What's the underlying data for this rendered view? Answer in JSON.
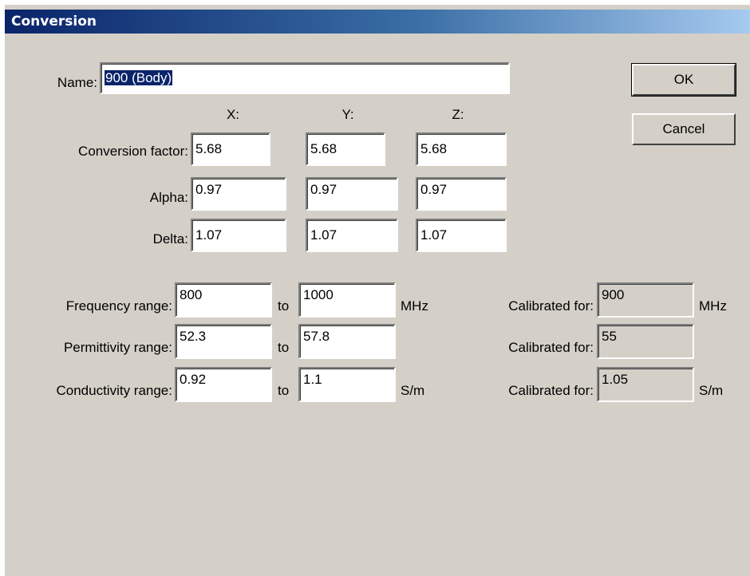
{
  "window": {
    "title": "Conversion"
  },
  "name": {
    "label": "Name:",
    "value": "900 (Body)"
  },
  "buttons": {
    "ok": "OK",
    "cancel": "Cancel"
  },
  "axes": {
    "x": "X:",
    "y": "Y:",
    "z": "Z:"
  },
  "conversion_factor": {
    "label": "Conversion factor:",
    "x": "5.68",
    "y": "5.68",
    "z": "5.68"
  },
  "alpha": {
    "label": "Alpha:",
    "x": "0.97",
    "y": "0.97",
    "z": "0.97"
  },
  "delta": {
    "label": "Delta:",
    "x": "1.07",
    "y": "1.07",
    "z": "1.07"
  },
  "frequency": {
    "label": "Frequency range:",
    "from": "800",
    "to_label": "to",
    "to": "1000",
    "unit": "MHz",
    "calibrated_label": "Calibrated for:",
    "calibrated": "900",
    "calibrated_unit": "MHz"
  },
  "permittivity": {
    "label": "Permittivity range:",
    "from": "52.3",
    "to_label": "to",
    "to": "57.8",
    "calibrated_label": "Calibrated for:",
    "calibrated": "55"
  },
  "conductivity": {
    "label": "Conductivity range:",
    "from": "0.92",
    "to_label": "to",
    "to": "1.1",
    "unit": "S/m",
    "calibrated_label": "Calibrated for:",
    "calibrated": "1.05",
    "calibrated_unit": "S/m"
  }
}
